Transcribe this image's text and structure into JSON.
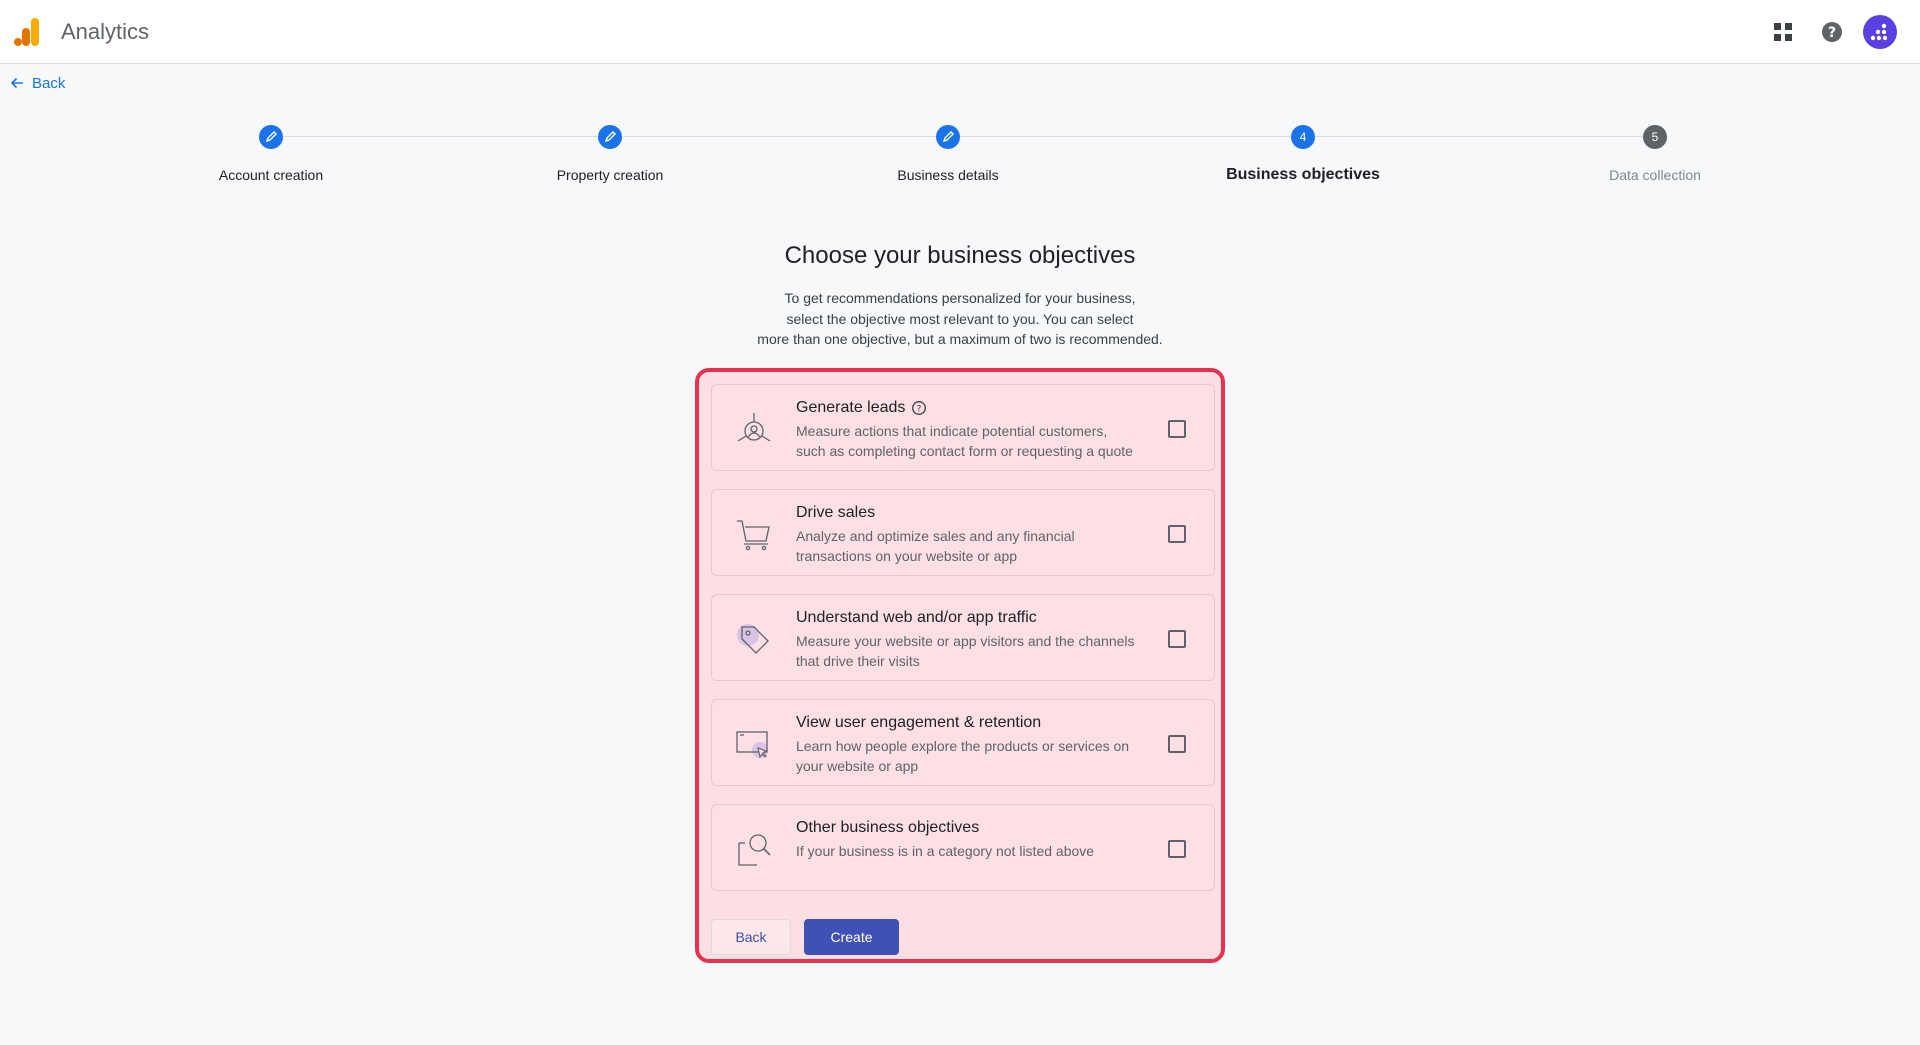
{
  "header": {
    "app_title": "Analytics",
    "apps_icon": "apps-grid-icon",
    "help_icon": "help-circle-icon",
    "avatar_icon": "account-avatar-icon"
  },
  "back_link": {
    "label": "Back",
    "icon": "arrow-left-icon"
  },
  "stepper": {
    "steps": [
      {
        "label": "Account creation",
        "state": "done"
      },
      {
        "label": "Property creation",
        "state": "done"
      },
      {
        "label": "Business details",
        "state": "done"
      },
      {
        "label": "Business objectives",
        "state": "current",
        "number": "4"
      },
      {
        "label": "Data collection",
        "state": "todo",
        "number": "5"
      }
    ]
  },
  "main": {
    "title": "Choose your business objectives",
    "description_lines": [
      "To get recommendations personalized for your business,",
      "select the objective most relevant to you. You can select",
      "more than one objective, but a maximum of two is recommended."
    ]
  },
  "options": [
    {
      "title": "Generate leads",
      "desc_lines": [
        "Measure actions that indicate potential customers,",
        "such as completing contact form or requesting a quote"
      ],
      "icon": "leads-icon",
      "checked": false
    },
    {
      "title": "Drive sales",
      "desc_lines": [
        "Analyze and optimize sales and any financial",
        "transactions on your website or app"
      ],
      "icon": "cart-icon",
      "checked": false
    },
    {
      "title": "Understand web and/or app traffic",
      "desc_lines": [
        "Measure your website or app visitors and the channels",
        "that drive their visits"
      ],
      "icon": "tag-icon",
      "checked": false
    },
    {
      "title": "View user engagement & retention",
      "desc_lines": [
        "Learn how people explore the products or services on",
        "your website or app"
      ],
      "icon": "screen-cursor-icon",
      "checked": false
    },
    {
      "title": "Other business objectives",
      "desc_lines": [
        "If your business is in a category not listed above"
      ],
      "icon": "magnify-doc-icon",
      "checked": false
    }
  ],
  "buttons": {
    "back": "Back",
    "create": "Create"
  },
  "colors": {
    "primary": "#1a73e8",
    "highlight_border": "#e8304f",
    "create_button": "#3f51b5",
    "avatar": "#5b3fe0"
  }
}
